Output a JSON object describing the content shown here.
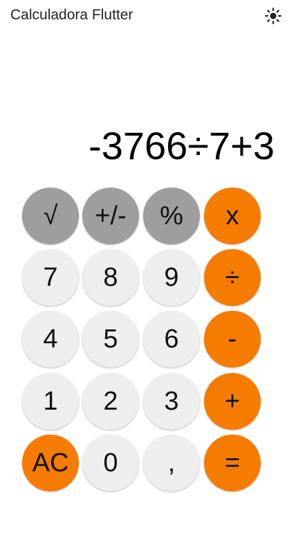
{
  "appbar": {
    "title": "Calculadora Flutter",
    "theme_icon": "sun-icon"
  },
  "display": {
    "expression": "-3766÷7+3"
  },
  "keys": {
    "sqrt": "√",
    "sign": "+/-",
    "percent": "%",
    "multiply": "x",
    "seven": "7",
    "eight": "8",
    "nine": "9",
    "divide": "÷",
    "four": "4",
    "five": "5",
    "six": "6",
    "minus": "-",
    "one": "1",
    "two": "2",
    "three": "3",
    "plus": "+",
    "clear": "AC",
    "zero": "0",
    "comma": ",",
    "equals": "="
  },
  "colors": {
    "function_key": "#9e9e9e",
    "operator_key": "#f57c00",
    "digit_key": "#eeeeee",
    "background": "#ffffff"
  }
}
